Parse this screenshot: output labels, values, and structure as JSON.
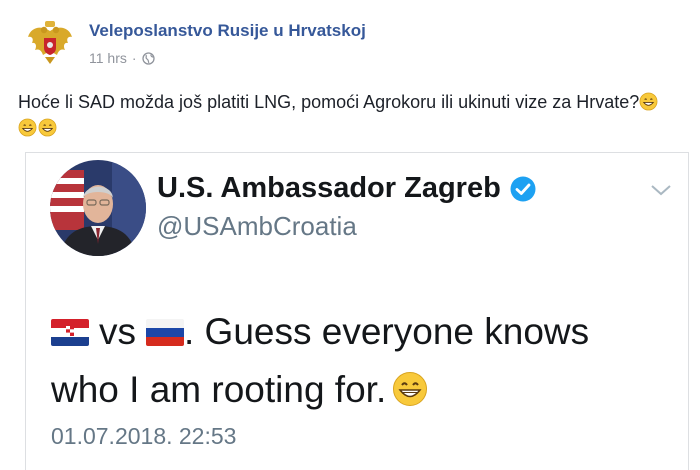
{
  "post": {
    "page_name": "Veleposlanstvo Rusije u Hrvatskoj",
    "time": "11 hrs",
    "separator": "·",
    "text": "Hoće li SAD možda još platiti LNG, pomoći Agrokoru ili ukinuti vize za Hrvate?",
    "emoji_icons": [
      "grinning-face-icon",
      "grinning-face-icon",
      "grinning-face-icon"
    ]
  },
  "tweet": {
    "display_name": "U.S. Ambassador Zagreb",
    "handle": "@USAmbCroatia",
    "flag_left": "croatia-flag-icon",
    "vs_text": "vs",
    "flag_right": "russia-flag-icon",
    "text_line1_rest": ". Guess everyone knows",
    "text_line2": "who I am rooting for.",
    "date": "01.07.2018. 22:53"
  },
  "colors": {
    "fb_link": "#365899",
    "twitter_verified": "#1da1f2",
    "meta_gray": "#90949c"
  }
}
